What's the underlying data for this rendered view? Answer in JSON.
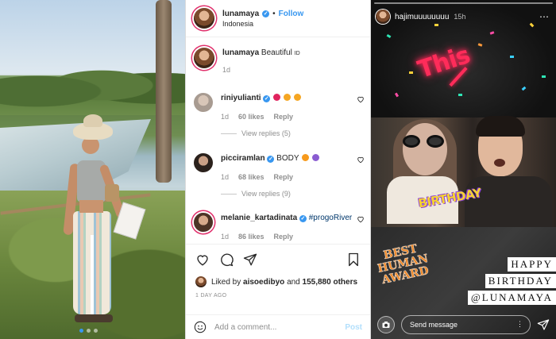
{
  "post": {
    "username": "lunamaya",
    "follow_label": "Follow",
    "separator": "•",
    "location": "Indonesia",
    "caption": {
      "username": "lunamaya",
      "text": "Beautiful",
      "time": "1d"
    },
    "comments": [
      {
        "username": "riniyulianti",
        "text": "",
        "time": "1d",
        "likes": "60 likes",
        "reply": "Reply",
        "view_replies": "View replies (5)"
      },
      {
        "username": "picciramlan",
        "text": "BODY",
        "time": "1d",
        "likes": "68 likes",
        "reply": "Reply",
        "view_replies": "View replies (9)"
      },
      {
        "username": "melanie_kartadinata",
        "text": "#progoRiver",
        "time": "1d",
        "likes": "86 likes",
        "reply": "Reply"
      }
    ],
    "liked_by_prefix": "Liked by",
    "liked_by_user": "aisoedibyo",
    "liked_by_and": "and",
    "liked_by_count": "155,880 others",
    "ago": "1 DAY AGO",
    "add_comment_placeholder": "Add a comment...",
    "post_label": "Post"
  },
  "story": {
    "username": "hajimuuuuuuuu",
    "time": "15h",
    "neon_text": "This",
    "birthday_sticker": "BIRTHDAY",
    "award_lines": [
      "BEST",
      "HUMAN",
      "AWARD"
    ],
    "hbd_lines": [
      "HAPPY",
      "BIRTHDAY",
      "@LUNAMAYA"
    ],
    "send_message_placeholder": "Send message"
  },
  "colors": {
    "verified": "#3897f0",
    "follow": "#3897f0",
    "story_bg": "#161616",
    "neon": "#ff2c5a"
  }
}
